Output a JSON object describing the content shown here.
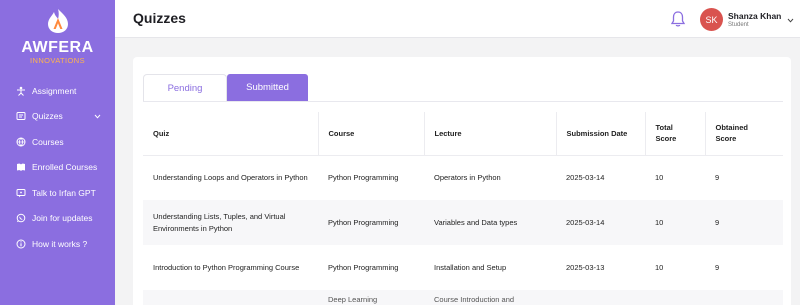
{
  "brand": {
    "title": "AWFERA",
    "subtitle": "INNOVATIONS"
  },
  "sidebar": {
    "items": [
      {
        "label": "Assignment",
        "icon": "assignment-icon"
      },
      {
        "label": "Quizzes",
        "icon": "quiz-icon",
        "expandable": true
      },
      {
        "label": "Courses",
        "icon": "globe-icon"
      },
      {
        "label": "Enrolled Courses",
        "icon": "book-icon"
      },
      {
        "label": "Talk to Irfan GPT",
        "icon": "chat-icon"
      },
      {
        "label": "Join for updates",
        "icon": "whatsapp-icon"
      },
      {
        "label": "How it works ?",
        "icon": "info-icon"
      }
    ]
  },
  "header": {
    "title": "Quizzes",
    "user": {
      "initials": "SK",
      "name": "Shanza Khan",
      "role": "Student"
    }
  },
  "tabs": {
    "pending": "Pending",
    "submitted": "Submitted",
    "active": "submitted"
  },
  "table": {
    "columns": {
      "quiz": "Quiz",
      "course": "Course",
      "lecture": "Lecture",
      "submission_date": "Submission Date",
      "total_score_1": "Total",
      "total_score_2": "Score",
      "obtained_score_1": "Obtained",
      "obtained_score_2": "Score"
    },
    "rows": [
      {
        "quiz": "Understanding Loops and Operators in Python",
        "course": "Python Programming",
        "lecture": "Operators in Python",
        "date": "2025-03-14",
        "total": "10",
        "obtained": "9"
      },
      {
        "quiz": "Understanding Lists, Tuples, and Virtual Environments in Python",
        "course": "Python Programming",
        "lecture": "Variables and Data types",
        "date": "2025-03-14",
        "total": "10",
        "obtained": "9"
      },
      {
        "quiz": "Introduction to Python Programming Course",
        "course": "Python Programming",
        "lecture": "Installation and Setup",
        "date": "2025-03-13",
        "total": "10",
        "obtained": "9"
      },
      {
        "quiz": "",
        "course": "Deep Learning",
        "lecture": "Course Introduction and",
        "date": "",
        "total": "",
        "obtained": ""
      }
    ]
  },
  "colors": {
    "accent": "#8b6ee0",
    "avatar": "#d9534f",
    "brand_sub": "#ffb34d"
  }
}
